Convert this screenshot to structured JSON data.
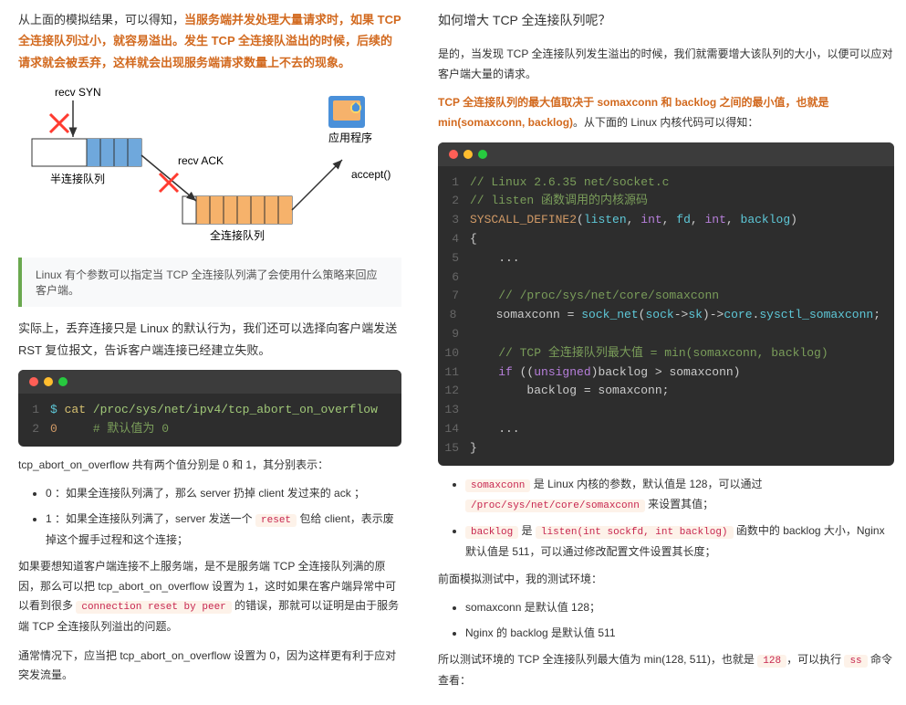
{
  "left": {
    "intro": "从上面的模拟结果，可以得知，",
    "intro_bold": "当服务端并发处理大量请求时，如果 TCP 全连接队列过小，就容易溢出。发生 TCP 全连接队溢出的时候，后续的请求就会被丢弃，这样就会出现服务端请求数量上不去的现象。",
    "diagram": {
      "recv_syn": "recv SYN",
      "half_queue": "半连接队列",
      "recv_ack": "recv ACK",
      "accept": "accept()",
      "full_queue": "全连接队列",
      "app": "应用程序"
    },
    "quote": "Linux 有个参数可以指定当 TCP 全连接队列满了会使用什么策略来回应客户端。",
    "para2_a": "实际上，丢弃连接只是 Linux 的默认行为，我们还可以选择向客户端发送 RST 复位报文，告诉客户端连接已经建立失败。",
    "code1": {
      "lines": [
        {
          "n": "1",
          "seg": [
            {
              "c": "c-cyan",
              "t": "$ "
            },
            {
              "c": "c-yellow",
              "t": "cat "
            },
            {
              "c": "c-green",
              "t": "/proc/sys/net/ipv4/tcp_abort_on_overflow"
            }
          ]
        },
        {
          "n": "2",
          "seg": [
            {
              "c": "c-orange",
              "t": "0     "
            },
            {
              "c": "c-comment",
              "t": "# 默认值为 0"
            }
          ]
        }
      ]
    },
    "para3": "tcp_abort_on_overflow 共有两个值分别是 0 和 1，其分别表示：",
    "list1": [
      "0 ：如果全连接队列满了，那么 server 扔掉 client 发过来的 ack ；",
      "1 ：如果全连接队列满了，server 发送一个 |reset| 包给 client，表示废掉这个握手过程和这个连接；"
    ],
    "para4_a": "如果要想知道客户端连接不上服务端，是不是服务端 TCP 全连接队列满的原因，那么可以把 tcp_abort_on_overflow 设置为 1，这时如果在客户端异常中可以看到很多 ",
    "para4_code": "connection reset by peer",
    "para4_b": " 的错误，那就可以证明是由于服务端 TCP 全连接队列溢出的问题。",
    "para5": "通常情况下，应当把 tcp_abort_on_overflow 设置为 0，因为这样更有利于应对突发流量。"
  },
  "right": {
    "h4": "如何增大 TCP 全连接队列呢？",
    "para1": "是的，当发现 TCP 全连接队列发生溢出的时候，我们就需要增大该队列的大小，以便可以应对客户端大量的请求。",
    "para2_bold": "TCP 全连接队列的最大值取决于 somaxconn 和 backlog 之间的最小值，也就是 min(somaxconn, backlog)",
    "para2_b": "。从下面的 Linux 内核代码可以得知：",
    "code2": {
      "lines": [
        {
          "n": "1",
          "seg": [
            {
              "c": "c-comment",
              "t": "// Linux 2.6.35 net/socket.c"
            }
          ]
        },
        {
          "n": "2",
          "seg": [
            {
              "c": "c-comment",
              "t": "// listen 函数调用的内核源码"
            }
          ]
        },
        {
          "n": "3",
          "seg": [
            {
              "c": "c-orange",
              "t": "SYSCALL_DEFINE2"
            },
            {
              "c": "c-white",
              "t": "("
            },
            {
              "c": "c-cyan",
              "t": "listen"
            },
            {
              "c": "c-white",
              "t": ", "
            },
            {
              "c": "c-purple",
              "t": "int"
            },
            {
              "c": "c-white",
              "t": ", "
            },
            {
              "c": "c-cyan",
              "t": "fd"
            },
            {
              "c": "c-white",
              "t": ", "
            },
            {
              "c": "c-purple",
              "t": "int"
            },
            {
              "c": "c-white",
              "t": ", "
            },
            {
              "c": "c-cyan",
              "t": "backlog"
            },
            {
              "c": "c-white",
              "t": ")"
            }
          ]
        },
        {
          "n": "4",
          "seg": [
            {
              "c": "c-white",
              "t": "{"
            }
          ]
        },
        {
          "n": "5",
          "seg": [
            {
              "c": "c-white",
              "t": "    ..."
            }
          ]
        },
        {
          "n": "6",
          "seg": [
            {
              "c": "c-white",
              "t": ""
            }
          ]
        },
        {
          "n": "7",
          "seg": [
            {
              "c": "c-comment",
              "t": "    // /proc/sys/net/core/somaxconn"
            }
          ]
        },
        {
          "n": "8",
          "seg": [
            {
              "c": "c-white",
              "t": "    somaxconn = "
            },
            {
              "c": "c-cyan",
              "t": "sock_net"
            },
            {
              "c": "c-white",
              "t": "("
            },
            {
              "c": "c-cyan",
              "t": "sock"
            },
            {
              "c": "c-white",
              "t": "->"
            },
            {
              "c": "c-cyan",
              "t": "sk"
            },
            {
              "c": "c-white",
              "t": ")->"
            },
            {
              "c": "c-cyan",
              "t": "core"
            },
            {
              "c": "c-white",
              "t": "."
            },
            {
              "c": "c-cyan",
              "t": "sysctl_somaxconn"
            },
            {
              "c": "c-white",
              "t": ";"
            }
          ]
        },
        {
          "n": "9",
          "seg": [
            {
              "c": "c-white",
              "t": ""
            }
          ]
        },
        {
          "n": "10",
          "seg": [
            {
              "c": "c-comment",
              "t": "    // TCP 全连接队列最大值 = min(somaxconn, backlog)"
            }
          ]
        },
        {
          "n": "11",
          "seg": [
            {
              "c": "c-purple",
              "t": "    if"
            },
            {
              "c": "c-white",
              "t": " (("
            },
            {
              "c": "c-purple",
              "t": "unsigned"
            },
            {
              "c": "c-white",
              "t": ")backlog > somaxconn)"
            }
          ]
        },
        {
          "n": "12",
          "seg": [
            {
              "c": "c-white",
              "t": "        backlog = somaxconn;"
            }
          ]
        },
        {
          "n": "13",
          "seg": [
            {
              "c": "c-white",
              "t": ""
            }
          ]
        },
        {
          "n": "14",
          "seg": [
            {
              "c": "c-white",
              "t": "    ..."
            }
          ]
        },
        {
          "n": "15",
          "seg": [
            {
              "c": "c-white",
              "t": "}"
            }
          ]
        }
      ]
    },
    "list2": [
      {
        "code": "somaxconn",
        "t1": " 是 Linux 内核的参数，默认值是 128，可以通过 ",
        "code2": "/proc/sys/net/core/somaxconn",
        "t2": " 来设置其值；"
      },
      {
        "code": "backlog",
        "t1": " 是 ",
        "code2": "listen(int sockfd, int backlog)",
        "t2": " 函数中的 backlog 大小，Nginx 默认值是 511，可以通过修改配置文件设置其长度；"
      }
    ],
    "para3": "前面模拟测试中，我的测试环境：",
    "list3": [
      "somaxconn 是默认值 128；",
      "Nginx 的 backlog 是默认值 511"
    ],
    "para4_a": "所以测试环境的 TCP 全连接队列最大值为 min(128, 511)，也就是 ",
    "para4_c1": "128",
    "para4_b": "，可以执行 ",
    "para4_c2": "ss",
    "para4_c": " 命令查看："
  }
}
